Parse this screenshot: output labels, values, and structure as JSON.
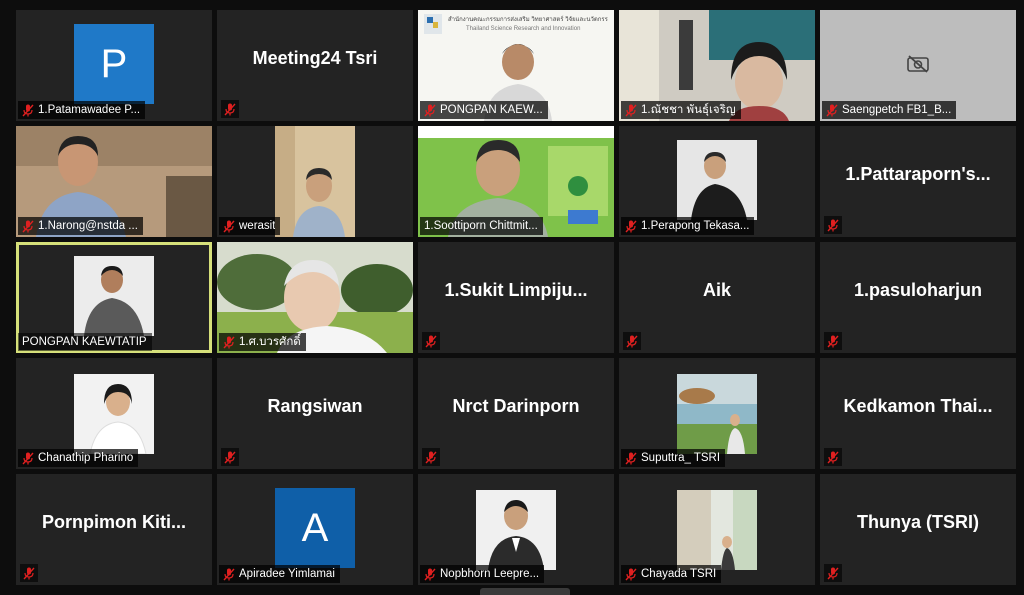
{
  "colors": {
    "tile_bg": "#232323",
    "active_border": "#d6e07a",
    "avatar_p": "#1f79c8",
    "avatar_a": "#0f5fa8",
    "mute_red": "#e02020"
  },
  "tiles": [
    {
      "label": "1.Patamawadee P...",
      "avatar_letter": "P"
    },
    {
      "label": "",
      "big": "Meeting24 Tsri"
    },
    {
      "label": "PONGPAN KAEW...",
      "slide_header": "สำนักงานคณะกรรมการส่งเสริม วิทยาศาสตร์ วิจัยและนวัตกรรม",
      "slide_sub": "Thailand Science Research and Innovation"
    },
    {
      "label": "1.ณัชชา พันธุ์เจริญ"
    },
    {
      "label": "Saengpetch FB1_B..."
    },
    {
      "label": "1.Narong@nstda ..."
    },
    {
      "label": "werasit"
    },
    {
      "label": "1.Soottiporn Chittmit..."
    },
    {
      "label": "1.Perapong Tekasa..."
    },
    {
      "label": "",
      "big": "1.Pattaraporn's..."
    },
    {
      "label": "PONGPAN KAEWTATIP"
    },
    {
      "label": "1.ศ.บวรศักดิ์"
    },
    {
      "label": "",
      "big": "1.Sukit  Limpiju..."
    },
    {
      "label": "",
      "big": "Aik"
    },
    {
      "label": "",
      "big": "1.pasuloharjun"
    },
    {
      "label": "Chanathip Pharino"
    },
    {
      "label": "",
      "big": "Rangsiwan"
    },
    {
      "label": "",
      "big": "Nrct Darinporn"
    },
    {
      "label": "Suputtra_ TSRI"
    },
    {
      "label": "",
      "big": "Kedkamon  Thai..."
    },
    {
      "label": "",
      "big": "Pornpimon  Kiti..."
    },
    {
      "label": "Apiradee Yimlamai",
      "avatar_letter": "A"
    },
    {
      "label": "Nopbhorn Leepre..."
    },
    {
      "label": "Chayada TSRI"
    },
    {
      "label": "",
      "big": "Thunya (TSRI)"
    }
  ]
}
